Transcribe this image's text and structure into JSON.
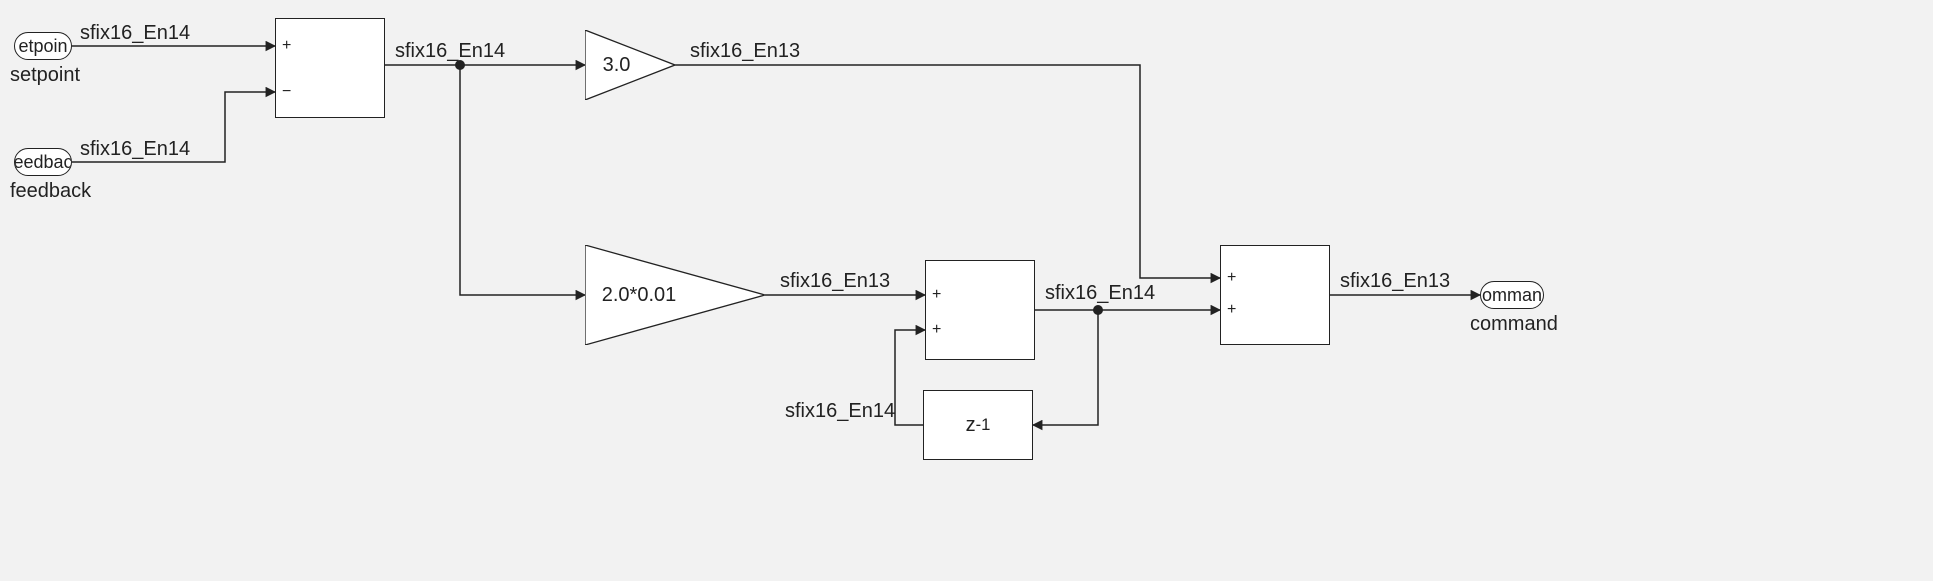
{
  "ports": {
    "setpoint": {
      "visibleText": "etpoin",
      "label": "setpoint"
    },
    "feedback": {
      "visibleText": "eedbac",
      "label": "feedback"
    },
    "command": {
      "visibleText": "omman",
      "label": "command"
    }
  },
  "signals": {
    "setpoint_type": "sfix16_En14",
    "feedback_type": "sfix16_En14",
    "error_type": "sfix16_En14",
    "gainP_out_type": "sfix16_En13",
    "gainI_out_type": "sfix16_En13",
    "integ_out_type": "sfix16_En14",
    "delay_in_type": "sfix16_En14",
    "command_type": "sfix16_En13"
  },
  "blocks": {
    "sum_error": {
      "in1": "+",
      "in2": "−"
    },
    "gainP": {
      "value": "3.0"
    },
    "gainI": {
      "value": "2.0*0.01"
    },
    "sum_integ": {
      "in1": "+",
      "in2": "+"
    },
    "delay": {
      "label_html": "z<sup>-1</sup>"
    },
    "sum_out": {
      "in1": "+",
      "in2": "+"
    }
  }
}
